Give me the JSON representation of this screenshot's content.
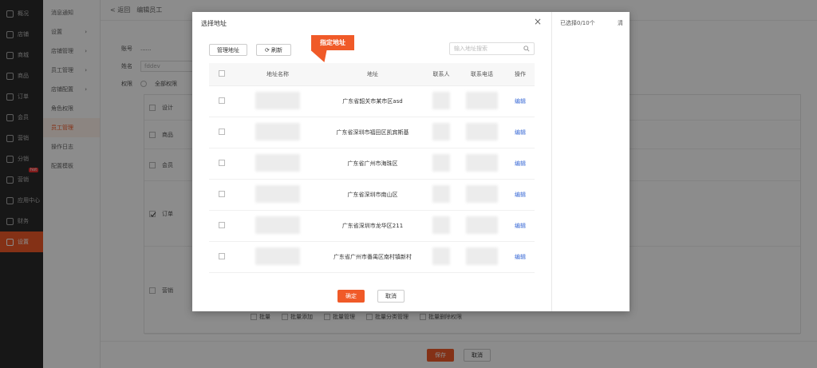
{
  "sidebar": {
    "items": [
      {
        "label": "概况"
      },
      {
        "label": "店铺"
      },
      {
        "label": "商城"
      },
      {
        "label": "商品"
      },
      {
        "label": "订单"
      },
      {
        "label": "会员"
      },
      {
        "label": "营销"
      },
      {
        "label": "分销"
      },
      {
        "label": "营销"
      },
      {
        "label": "应用中心"
      },
      {
        "label": "财务"
      },
      {
        "label": "设置"
      }
    ],
    "hot_badge": "hot",
    "active_index": 11
  },
  "subnav": {
    "items": [
      {
        "label": "消息通知",
        "arrow": ""
      },
      {
        "label": "设置",
        "arrow": "›"
      },
      {
        "label": "店铺管理",
        "arrow": "›"
      },
      {
        "label": "员工管理",
        "arrow": "›"
      },
      {
        "label": "店铺配置",
        "arrow": "›"
      },
      {
        "label": "角色权限",
        "arrow": ""
      },
      {
        "label": "员工管理",
        "arrow": ""
      },
      {
        "label": "操作日志",
        "arrow": ""
      },
      {
        "label": "配置模板",
        "arrow": ""
      }
    ],
    "active_index": 6
  },
  "main": {
    "breadcrumb": {
      "back": "< 返回",
      "current": "编辑员工"
    },
    "form": {
      "account_label": "账号",
      "account_value": "......",
      "name_label": "姓名",
      "name_value": "fddev",
      "perm_label": "权限",
      "perm_option_all": "全部权限"
    },
    "perm_rows": [
      {
        "label": "设计",
        "checked": false
      },
      {
        "label": "商品",
        "checked": false
      },
      {
        "label": "会员",
        "checked": false
      },
      {
        "label": "订单",
        "checked": true
      },
      {
        "label": "营销",
        "checked": false
      }
    ],
    "bottom_perm_items": [
      "批量",
      "批量添加",
      "批量管理",
      "批量分类管理",
      "批量删除权限"
    ],
    "save_label": "保存",
    "cancel_label": "取消"
  },
  "dialog": {
    "title": "选择地址",
    "close_glyph": "×",
    "manage_button": "管理地址",
    "refresh_button": "⟳ 刷新",
    "search_placeholder": "输入地址搜索",
    "callout": "指定地址",
    "selected_label": "已选择0/10个",
    "clear_label": "清",
    "columns": [
      "",
      "地址名称",
      "地址",
      "联系人",
      "联系电话",
      "操作"
    ],
    "rows": [
      {
        "address": "广东省韶关市某市区asd",
        "action": "编辑"
      },
      {
        "address": "广东省深圳市福田区凯宾斯基",
        "action": "编辑"
      },
      {
        "address": "广东省广州市海珠区",
        "action": "编辑"
      },
      {
        "address": "广东省深圳市南山区",
        "action": "编辑"
      },
      {
        "address": "广东省深圳市龙华区211",
        "action": "编辑"
      },
      {
        "address": "广东省广州市番禺区南村镇新村",
        "action": "编辑"
      }
    ],
    "confirm_label": "确定",
    "cancel_label": "取消"
  },
  "colors": {
    "accent": "#f05a28",
    "link": "#3b6bd6",
    "sidebar_bg": "#2b2b2b"
  }
}
